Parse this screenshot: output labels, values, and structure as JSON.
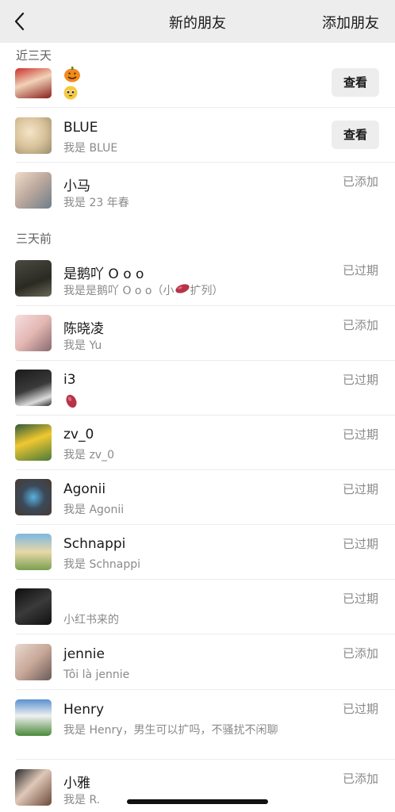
{
  "nav": {
    "title": "新的朋友",
    "add_label": "添加朋友"
  },
  "sections": {
    "recent": "近三天",
    "older": "三天前"
  },
  "recent_rows": [
    {
      "name": "",
      "msg": "",
      "action": "查看"
    },
    {
      "name": "BLUE",
      "msg": "我是 BLUE",
      "action": "查看"
    },
    {
      "name": "小马",
      "msg": "我是 23 年春",
      "status": "已添加"
    }
  ],
  "older_rows": [
    {
      "name": "是鹅吖 O o o",
      "msg_prefix": "我是是鹅吖 O o o（小",
      "msg_suffix": "扩列）",
      "status": "已过期"
    },
    {
      "name": "陈晓凌",
      "msg": "我是 Yu",
      "status": "已添加"
    },
    {
      "name": "i3",
      "msg": "",
      "status": "已过期"
    },
    {
      "name": "zv_0",
      "msg": "我是 zv_0",
      "status": "已过期"
    },
    {
      "name": "Agonii",
      "msg": "我是 Agonii",
      "status": "已过期"
    },
    {
      "name": "Schnappi",
      "msg": "我是 Schnappi",
      "status": "已过期"
    },
    {
      "name": "",
      "msg": "小红书来的",
      "status": "已过期"
    },
    {
      "name": "jennie",
      "msg": "Tôi là jennie",
      "status": "已添加"
    },
    {
      "name": "Henry",
      "msg": "我是 Henry，男生可以扩吗，不骚扰不闲聊",
      "status": "已过期"
    },
    {
      "name": "小雅",
      "msg": "我是 R.",
      "status": "已添加"
    }
  ],
  "icons": {
    "back": "chevron-left-icon",
    "pumpkin": "pumpkin-emoji-icon",
    "pleading": "pleading-face-emoji-icon",
    "sweet_potato": "sweet-potato-emoji-icon"
  }
}
